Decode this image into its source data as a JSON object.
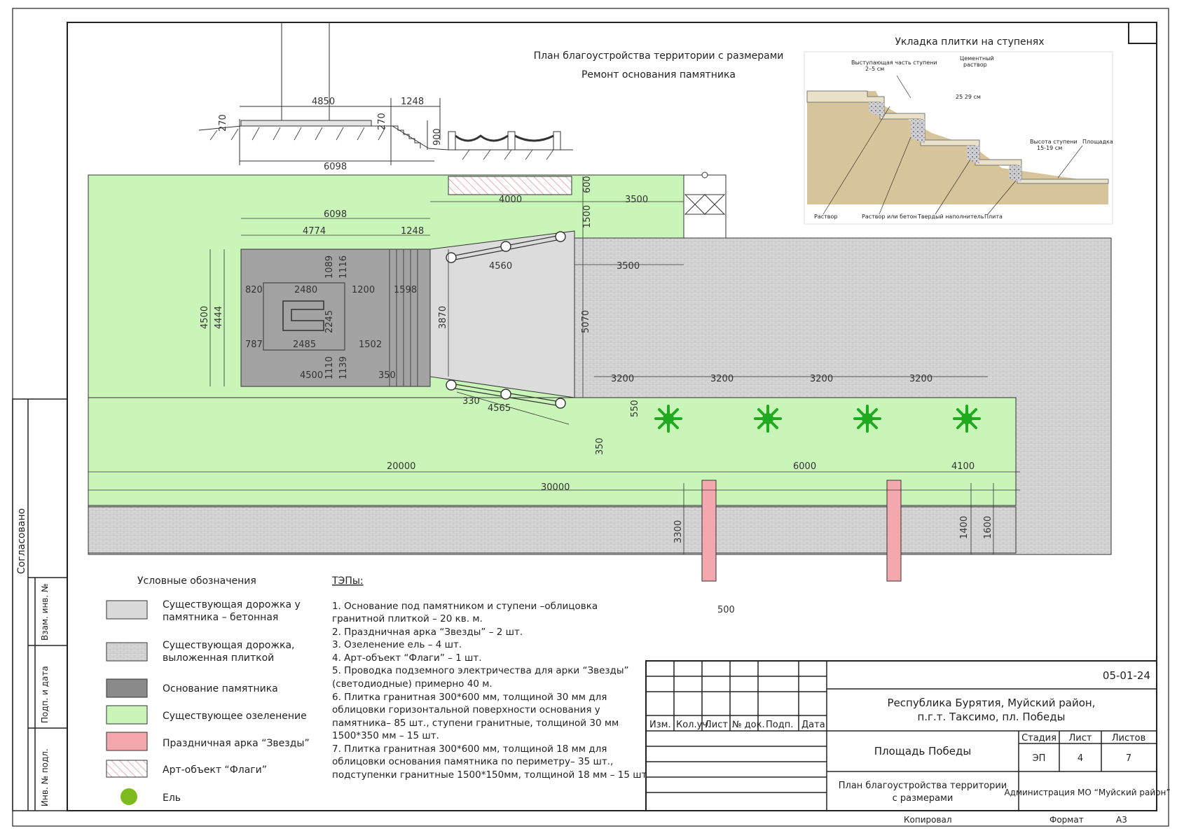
{
  "headings": {
    "plan_title": "План благоустройства территории с размерами",
    "plan_subtitle": "Ремонт основания памятника",
    "stair_title": "Укладка плитки на ступенях"
  },
  "stair_detail": {
    "labels": [
      "Выступающая часть ступени",
      "2–5 см",
      "Цементный",
      "раствор",
      "25 29 см",
      "Высота ступени",
      "15-19 см",
      "Площадка",
      "Раствор",
      "Раствор или бетон",
      "Твердый наполнитель",
      "Плита"
    ]
  },
  "dimensions": {
    "top": [
      "4850",
      "1248",
      "270",
      "270",
      "900",
      "6098"
    ],
    "plan": [
      "4000",
      "600",
      "3500",
      "1500",
      "6098",
      "4774",
      "1248",
      "4560",
      "3500",
      "1089",
      "1116",
      "820",
      "2480",
      "1200",
      "1598",
      "4500",
      "4444",
      "2245",
      "3870",
      "5070",
      "787",
      "2485",
      "1502",
      "4500",
      "1110",
      "1139",
      "350",
      "3200",
      "3200",
      "3200",
      "3200",
      "330",
      "4565",
      "550",
      "350",
      "20000",
      "6000",
      "4100",
      "30000",
      "3300",
      "1400",
      "1600",
      "500"
    ]
  },
  "legend": {
    "title": "Условные обозначения",
    "items": [
      {
        "label": "Существующая дорожка у",
        "label2": "памятника – бетонная",
        "color": "#d9d9d9",
        "kind": "fill"
      },
      {
        "label": "Существующая дорожка,",
        "label2": "выложенная плиткой",
        "color": "#cfcfcf",
        "kind": "tile"
      },
      {
        "label": "Основание памятника",
        "label2": "",
        "color": "#8a8a8a",
        "kind": "fill"
      },
      {
        "label": "Существующее озеленение",
        "label2": "",
        "color": "#c9f5b9",
        "kind": "fill"
      },
      {
        "label": "Праздничная арка “Звезды”",
        "label2": "",
        "color": "#f4a7ad",
        "kind": "fill"
      },
      {
        "label": "Арт-объект “Флаги”",
        "label2": "",
        "color": "#e07a80",
        "kind": "hatch"
      },
      {
        "label": "Ель",
        "label2": "",
        "color": "#7dbb1e",
        "kind": "dot"
      }
    ]
  },
  "tep": {
    "title": "ТЭПы:",
    "lines": [
      "1. Основание под памятником и ступени –облицовка",
      "гранитной плиткой – 20 кв. м.",
      "2. Праздничная арка “Звезды” – 2 шт.",
      "3. Озеленение ель – 4 шт.",
      "4. Арт-объект “Флаги” – 1 шт.",
      "5. Проводка подземного электричества для арки “Звезды”",
      "(светодиодные) примерно 40 м.",
      "6. Плитка гранитная 300*600 мм, толщиной 30 мм для",
      "облицовки горизонтальной поверхности основания у",
      "памятника– 85 шт., ступени гранитные, толщиной 30 мм",
      "1500*350 мм – 15 шт.",
      "7. Плитка гранитная 300*600 мм, толщиной 18 мм  для",
      "облицовки основания памятника по периметру– 35 шт.,",
      "подступенки гранитные 1500*150мм, толщиной 18 мм – 15 шт."
    ]
  },
  "side_stamp": {
    "agreed": "Согласовано",
    "fields": [
      "Взам. инв. №",
      "Подп. и дата",
      "Инв. № подл."
    ]
  },
  "title_block": {
    "code": "05-01-24",
    "location_line1": "Республика Бурятия, Муйский район,",
    "location_line2": "п.г.т. Таксимо, пл. Победы",
    "object": "Площадь Победы",
    "sheet_title_1": "План благоустройства территории",
    "sheet_title_2": "с размерами",
    "org": "Администрация МО “Муйский район”",
    "columns": [
      "Изм.",
      "Кол.уч.",
      "Лист",
      "№ док.",
      "Подп.",
      "Дата"
    ],
    "stage_label": "Стадия",
    "sheet_label": "Лист",
    "sheets_label": "Листов",
    "stage": "ЭП",
    "sheet": "4",
    "sheets": "7",
    "copied": "Копировал",
    "format_label": "Формат",
    "format": "А3"
  },
  "colors": {
    "green": "#c9f5b9",
    "tile": "#d3d3d3",
    "concrete": "#dcdcdc",
    "base": "#a3a3a3",
    "arch": "#f4a7ad",
    "tree": "#1faa1f"
  }
}
